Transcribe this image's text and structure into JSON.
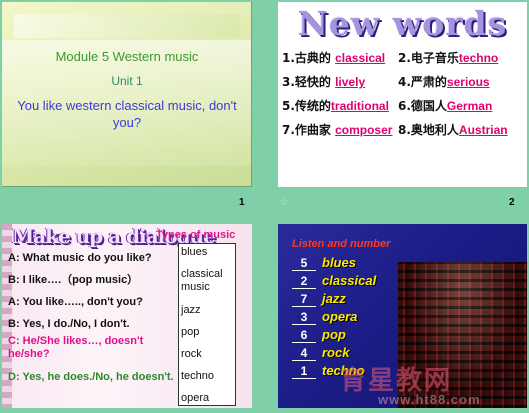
{
  "slide1": {
    "page_number": "1",
    "line1": "Module 5    Western music",
    "line2": "Unit 1",
    "line3": "You like western classical music, don't you?"
  },
  "slide2": {
    "page_number": "2",
    "title": "New words",
    "words": [
      {
        "prefix": "1.古典的 ",
        "answer": "classical"
      },
      {
        "prefix": "2.电子音乐",
        "answer": "techno"
      },
      {
        "prefix": "3.轻快的 ",
        "answer": "lively"
      },
      {
        "prefix": "4.严肃的",
        "answer": "serious"
      },
      {
        "prefix": "5.传统的",
        "answer": "traditional"
      },
      {
        "prefix": "6.德国人",
        "answer": "German"
      },
      {
        "prefix": "7.作曲家 ",
        "answer": "composer"
      },
      {
        "prefix": "8.奥地利人",
        "answer": "Austrian"
      }
    ]
  },
  "slide3": {
    "title": "Make up a dialogue",
    "types_label": "Types of music",
    "types": [
      "blues",
      "classical music",
      "jazz",
      "pop",
      "rock",
      "techno",
      "opera"
    ],
    "dialogue": [
      {
        "text": "A: What music do you like?",
        "color": "#111111"
      },
      {
        "text": "B: I like….（pop music）",
        "color": "#111111"
      },
      {
        "text": "A: You like….., don't you?",
        "color": "#111111"
      },
      {
        "text": "B: Yes, I do./No, I don't.",
        "color": "#111111"
      },
      {
        "text": "C: He/She likes…, doesn't he/she?",
        "color": "#e0108a"
      },
      {
        "text": "D: Yes, he does./No, he doesn't.",
        "color": "#2a8a2a"
      }
    ]
  },
  "slide4": {
    "heading": "Listen and number",
    "items": [
      {
        "number": "5",
        "genre": "blues"
      },
      {
        "number": "2",
        "genre": "classical"
      },
      {
        "number": "7",
        "genre": "jazz"
      },
      {
        "number": "3",
        "genre": "opera"
      },
      {
        "number": "6",
        "genre": "pop"
      },
      {
        "number": "4",
        "genre": "rock"
      },
      {
        "number": "1",
        "genre": "techno"
      }
    ],
    "watermark": "育星教网",
    "watermark_url": "www.ht88.com"
  }
}
